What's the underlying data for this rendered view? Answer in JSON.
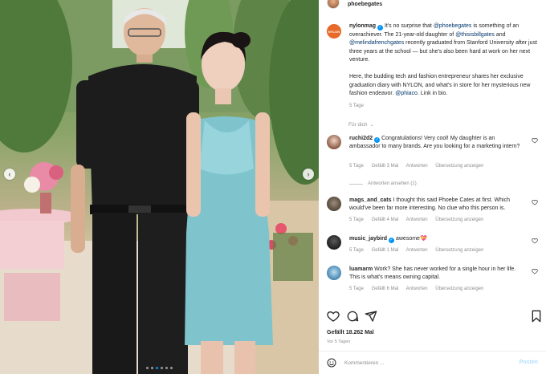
{
  "header": {
    "username": "phoebegates"
  },
  "caption": {
    "avatar_label": "NYLON",
    "username": "nylonmag",
    "paragraph1_prefix": " It's no surprise that ",
    "mention1": "@phoebegates",
    "paragraph1_mid1": " is something of an overachiever. The 21-year-old daughter of ",
    "mention2": "@thisisbillgates",
    "paragraph1_mid2": " and ",
    "mention3": "@melindafrenchgates",
    "paragraph1_suffix": " recently graduated from Stanford University after just three years at the school — but she's also been hard at work on her next venture.",
    "paragraph2_prefix": "Here, the budding tech and fashion entrepreneur shares her exclusive graduation diary with NYLON, and what's in store for her mysterious new fashion endeavor. ",
    "mention4": "@phiaco",
    "paragraph2_suffix": ". Link in bio.",
    "age": "5 Tage",
    "translate_toggle": "Für dich"
  },
  "comments": [
    {
      "username": "ruchi2d2",
      "verified": true,
      "text": " Congratulations! Very cool! My daughter is an ambassador to many brands. Are you looking for a marketing intern?",
      "age": "5 Tage",
      "likes": "Gefällt 3 Mal",
      "reply": "Antworten",
      "translate": "Übersetzung anzeigen"
    },
    {
      "username": "mags_and_cats",
      "verified": false,
      "text": " I thought this said Phoebe Cates at first. Which would've been far more interesting. No clue who this person is.",
      "age": "5 Tage",
      "likes": "Gefällt 4 Mal",
      "reply": "Antworten",
      "translate": "Übersetzung anzeigen"
    },
    {
      "username": "music_jaybird",
      "verified": true,
      "text": " awesome",
      "emoji": "💝",
      "age": "5 Tage",
      "likes": "Gefällt 1 Mal",
      "reply": "Antworten",
      "translate": "Übersetzung anzeigen"
    },
    {
      "username": "luamarm",
      "verified": false,
      "text": " Work? She has never worked for a single hour in her life. This is what's means owning capital.",
      "age": "5 Tage",
      "likes": "Gefällt 6 Mal",
      "reply": "Antworten",
      "translate": "Übersetzung anzeigen"
    }
  ],
  "replies_toggle": "Antworten ansehen (1)",
  "likes": "Gefällt 18.262 Mal",
  "post_age": "Vor 5 Tagen",
  "comment_box": {
    "placeholder": "Kommentieren ...",
    "post_label": "Posten"
  },
  "carousel": {
    "slide_count": 6,
    "active_slide": 2
  },
  "icons": {
    "like": "heart-icon",
    "comment": "comment-icon",
    "share": "share-icon",
    "save": "bookmark-icon",
    "emoji": "emoji-icon",
    "prev": "chevron-left-icon",
    "next": "chevron-right-icon",
    "verified": "verified-badge-icon"
  },
  "colors": {
    "accent": "#0095f6",
    "nylon_brand": "#e8692a",
    "link": "#00376b",
    "muted": "#8e8e8e"
  }
}
